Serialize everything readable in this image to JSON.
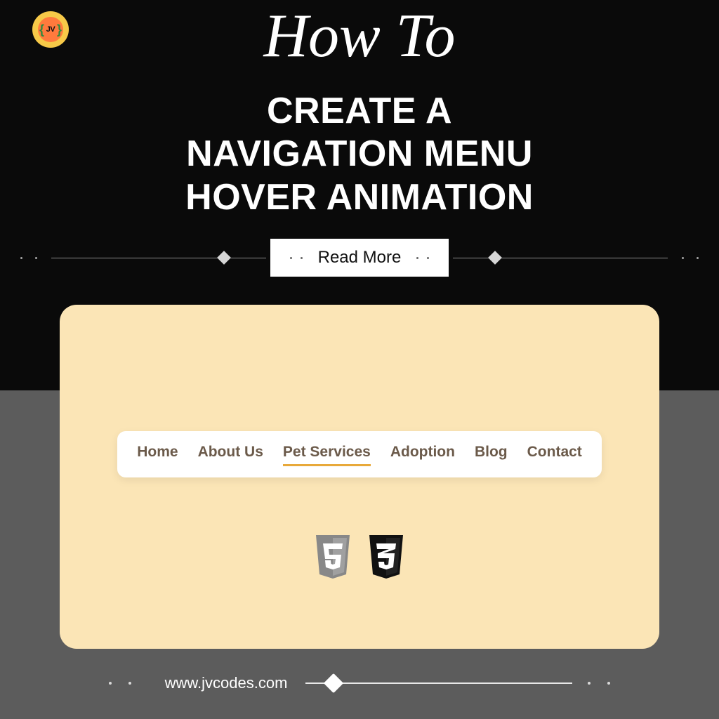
{
  "logo": {
    "text": "JV"
  },
  "eyebrow": "How To",
  "headline": {
    "line1": "CREATE A",
    "line2": "NAVIGATION MENU",
    "line3": "HOVER ANIMATION"
  },
  "cta": {
    "label": "Read More"
  },
  "nav": {
    "items": [
      {
        "label": "Home"
      },
      {
        "label": "About Us"
      },
      {
        "label": "Pet Services"
      },
      {
        "label": "Adoption"
      },
      {
        "label": "Blog"
      },
      {
        "label": "Contact"
      }
    ],
    "active_index": 2
  },
  "tech": {
    "html5": "5",
    "css3": "3"
  },
  "footer": {
    "url": "www.jvcodes.com"
  },
  "colors": {
    "card_bg": "#fbe5b6",
    "accent_underline": "#e8a93a",
    "logo_outer": "#f7c948",
    "logo_inner": "#ff7a3d"
  }
}
